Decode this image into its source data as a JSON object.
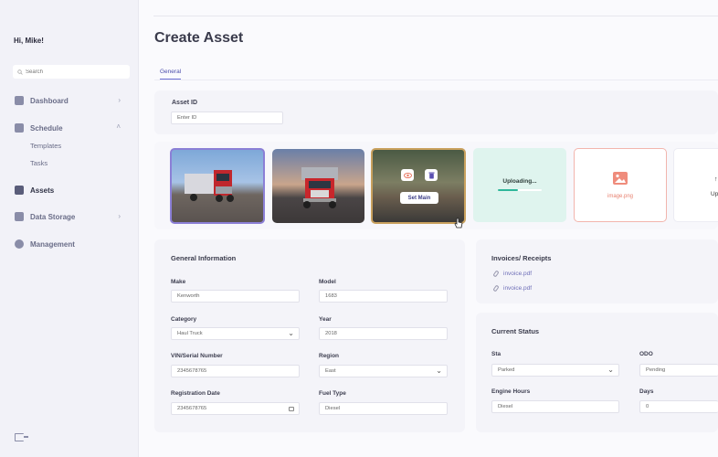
{
  "sidebar": {
    "greeting": "Hi, Mike!",
    "search_placeholder": "Search",
    "items": [
      {
        "label": "Dashboard"
      },
      {
        "label": "Schedule"
      },
      {
        "label": "Templates"
      },
      {
        "label": "Tasks"
      },
      {
        "label": "Assets"
      },
      {
        "label": "Data Storage"
      },
      {
        "label": "Management"
      }
    ]
  },
  "page": {
    "title": "Create Asset",
    "tab_general": "General"
  },
  "asset_id": {
    "label": "Asset ID",
    "placeholder": "Enter ID"
  },
  "images": {
    "set_main_label": "Set Main",
    "uploading_label": "Uploading...",
    "uploading_progress": 0.45,
    "image_file_name": "image.png",
    "upload_label_partial": "Up"
  },
  "general_info": {
    "title": "General Information",
    "make_label": "Make",
    "make_value": "Kenworth",
    "model_label": "Model",
    "model_value": "1683",
    "category_label": "Category",
    "category_value": "Haul Truck",
    "year_label": "Year",
    "year_value": "2018",
    "vin_label": "VIN/Serial Number",
    "vin_value": "2345678765",
    "region_label": "Region",
    "region_value": "East",
    "reg_date_label": "Registration Date",
    "reg_date_value": "2345678765",
    "fuel_label": "Fuel Type",
    "fuel_value": "Diesel"
  },
  "invoices": {
    "title": "Invoices/ Receipts",
    "files": [
      "invoice.pdf",
      "invoice.pdf"
    ]
  },
  "current_status": {
    "title": "Current Status",
    "sta_label": "Sta",
    "sta_value": "Parked",
    "odo_label": "ODO",
    "odo_value": "Pending",
    "engine_label": "Engine Hours",
    "engine_value": "Diesel",
    "days_label": "Days",
    "days_value": "0"
  },
  "colors": {
    "accent": "#6b6ed3",
    "upload_bg": "#dff4ee",
    "progress": "#2fb79a",
    "image_card_border": "#f2b5ad",
    "eye_icon": "#e8755f",
    "trash_icon": "#5a4fb0"
  }
}
